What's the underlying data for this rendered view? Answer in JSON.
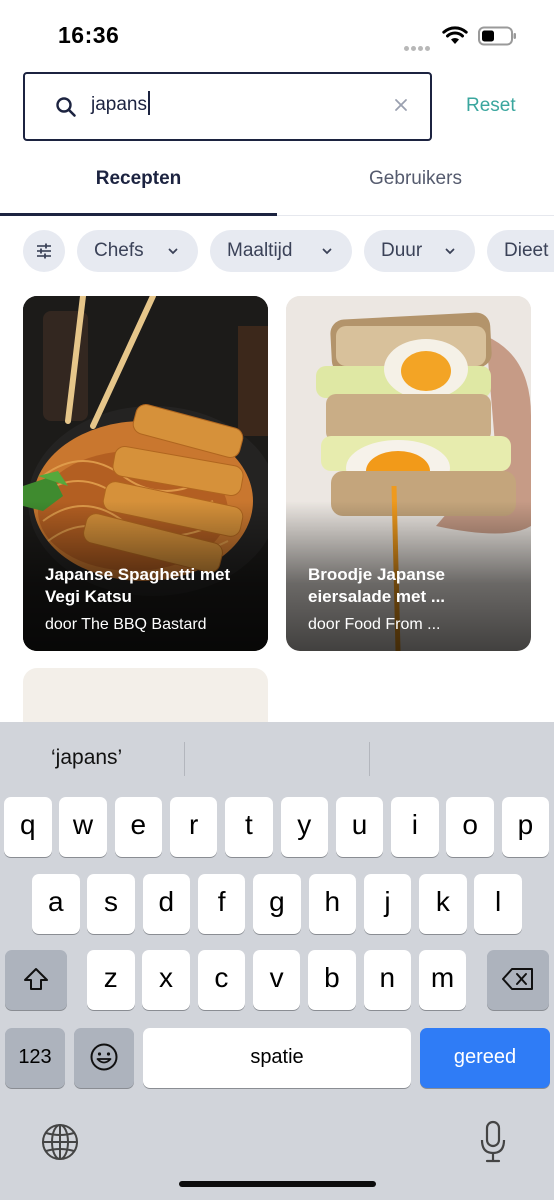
{
  "status_bar": {
    "time": "16:36"
  },
  "search": {
    "value": "japans",
    "reset_label": "Reset"
  },
  "tabs": [
    {
      "label": "Recepten",
      "active": true
    },
    {
      "label": "Gebruikers",
      "active": false
    }
  ],
  "filters": {
    "filter_icon": "sliders-icon",
    "chips": [
      "Chefs",
      "Maaltijd",
      "Duur",
      "Dieet"
    ]
  },
  "recipes": [
    {
      "title": "Japanse Spaghetti met Vegi Katsu",
      "author": "door The BBQ Bastard"
    },
    {
      "title": "Broodje Japanse eiersalade met ...",
      "author": "door Food From ..."
    }
  ],
  "keyboard": {
    "suggestion": "‘japans’",
    "rows": [
      [
        "q",
        "w",
        "e",
        "r",
        "t",
        "y",
        "u",
        "i",
        "o",
        "p"
      ],
      [
        "a",
        "s",
        "d",
        "f",
        "g",
        "h",
        "j",
        "k",
        "l"
      ],
      [
        "z",
        "x",
        "c",
        "v",
        "b",
        "n",
        "m"
      ]
    ],
    "numbers_label": "123",
    "space_label": "spatie",
    "return_label": "gereed"
  },
  "colors": {
    "accent": "#3aa69e",
    "text_dark": "#1c2340",
    "chip_bg": "#e7eaf1",
    "keyboard_bg": "#d1d4da",
    "return_key": "#2f7cf6"
  }
}
